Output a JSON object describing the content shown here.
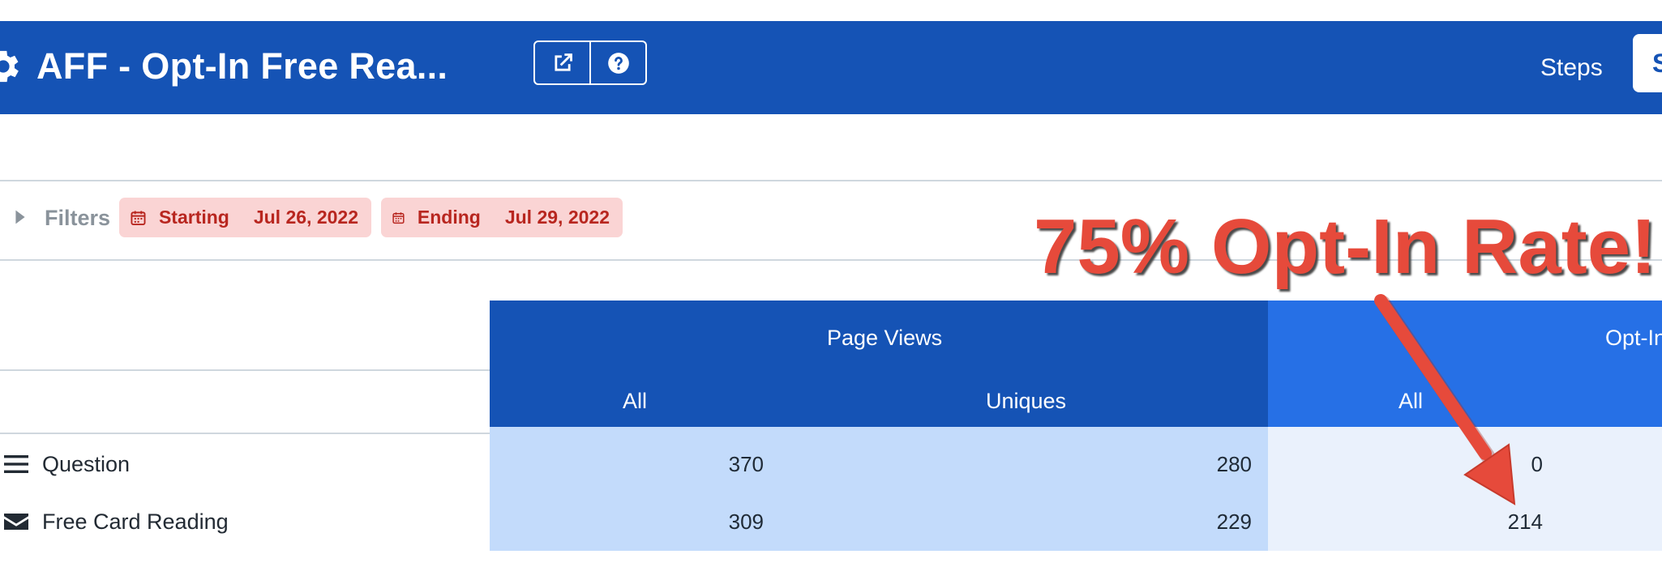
{
  "header": {
    "title": "AFF - Opt-In Free Rea...",
    "steps_label": "Steps",
    "right_button_label": "S"
  },
  "filters": {
    "label": "Filters",
    "starting": {
      "label": "Starting",
      "value": "Jul 26, 2022"
    },
    "ending": {
      "label": "Ending",
      "value": "Jul 29, 2022"
    }
  },
  "annotation": {
    "text": "75% Opt-In Rate!!"
  },
  "table": {
    "groups": [
      {
        "label": "Page Views"
      },
      {
        "label": "Opt-In"
      }
    ],
    "subheaders": [
      "All",
      "Uniques",
      "All"
    ],
    "rows": [
      {
        "label": "Question",
        "icon": "menu-icon",
        "values": [
          "370",
          "280",
          "0"
        ]
      },
      {
        "label": "Free Card Reading",
        "icon": "envelope-icon",
        "values": [
          "309",
          "229",
          "214"
        ]
      }
    ]
  },
  "colors": {
    "header_blue": "#1553b5",
    "optin_blue": "#2670e6",
    "chip_bg": "#fad4d4",
    "chip_text": "#b8261f",
    "annotation_red": "#e64a3b"
  }
}
